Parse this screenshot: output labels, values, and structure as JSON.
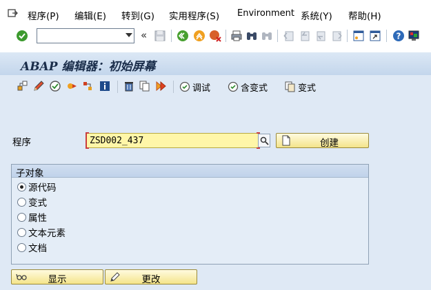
{
  "menu": {
    "items": [
      "程序(P)",
      "编辑(E)",
      "转到(G)",
      "实用程序(S)",
      "Environment",
      "系统(Y)",
      "帮助(H)"
    ]
  },
  "command_field": {
    "value": ""
  },
  "title": "ABAP 编辑器：初始屏幕",
  "app_toolbar": {
    "debug_label": "调试",
    "with_variant_label": "含变式",
    "variant_label": "变式"
  },
  "program": {
    "label": "程序",
    "value": "ZSD002_437",
    "create_label": "创建"
  },
  "subobjects": {
    "title": "子对象",
    "options": [
      "源代码",
      "变式",
      "属性",
      "文本元素",
      "文档"
    ],
    "selected": "源代码"
  },
  "actions": {
    "display_label": "显示",
    "change_label": "更改"
  },
  "colors": {
    "input_required_bg": "#fff6a8",
    "button_bg": "#f4e48a",
    "title_band": "#c3d6ec",
    "work_area": "#dfe9f5"
  }
}
